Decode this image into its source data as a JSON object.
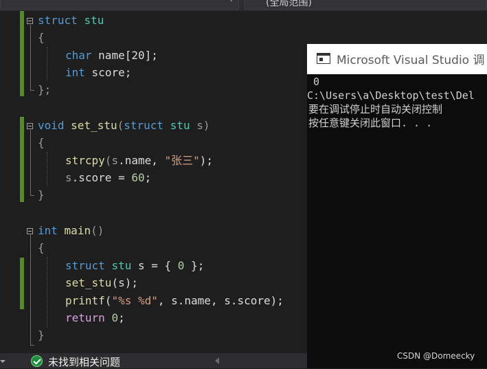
{
  "toolbar": {
    "scope": "(全局范围)"
  },
  "code": {
    "l1": {
      "kw": "struct",
      "ty": "stu"
    },
    "l2": "{",
    "l3": {
      "ty": "char",
      "rest": "name[20];"
    },
    "l4": {
      "kw": "int",
      "rest": "score;"
    },
    "l5": "};",
    "l6": {
      "kw": "void",
      "fn": "set_stu",
      "p1": "(",
      "kw2": "struct",
      "ty": "stu",
      "param": "s",
      "p2": ")"
    },
    "l7": "{",
    "l8": {
      "fn": "strcpy",
      "p1": "(",
      "a": "s",
      "b": ".name, ",
      "str": "\"张三\"",
      "end": ");"
    },
    "l9": {
      "a": "s",
      "b": ".score = ",
      "num": "60",
      "end": ";"
    },
    "l10": "}",
    "l11": {
      "kw": "int",
      "fn": "main",
      "p": "()"
    },
    "l12": "{",
    "l13": {
      "kw": "struct",
      "ty": "stu",
      "rest": " s = { ",
      "num": "0",
      "end": " };"
    },
    "l14": {
      "fn": "set_stu",
      "rest": "(s);"
    },
    "l15": {
      "fn": "printf",
      "p1": "(",
      "str": "\"%s %d\"",
      "rest": ", s.name, s.score);"
    },
    "l16": {
      "ctl": "return",
      "num": "0",
      "end": ";"
    },
    "l17": "}"
  },
  "console": {
    "title": "Microsoft Visual Studio 调",
    "lines": [
      " 0",
      "C:\\Users\\a\\Desktop\\test\\Del",
      "要在调试停止时自动关闭控制",
      "按任意键关闭此窗口. . ."
    ]
  },
  "status": {
    "text": "未找到相关问题"
  },
  "watermark": "CSDN @Domeecky"
}
